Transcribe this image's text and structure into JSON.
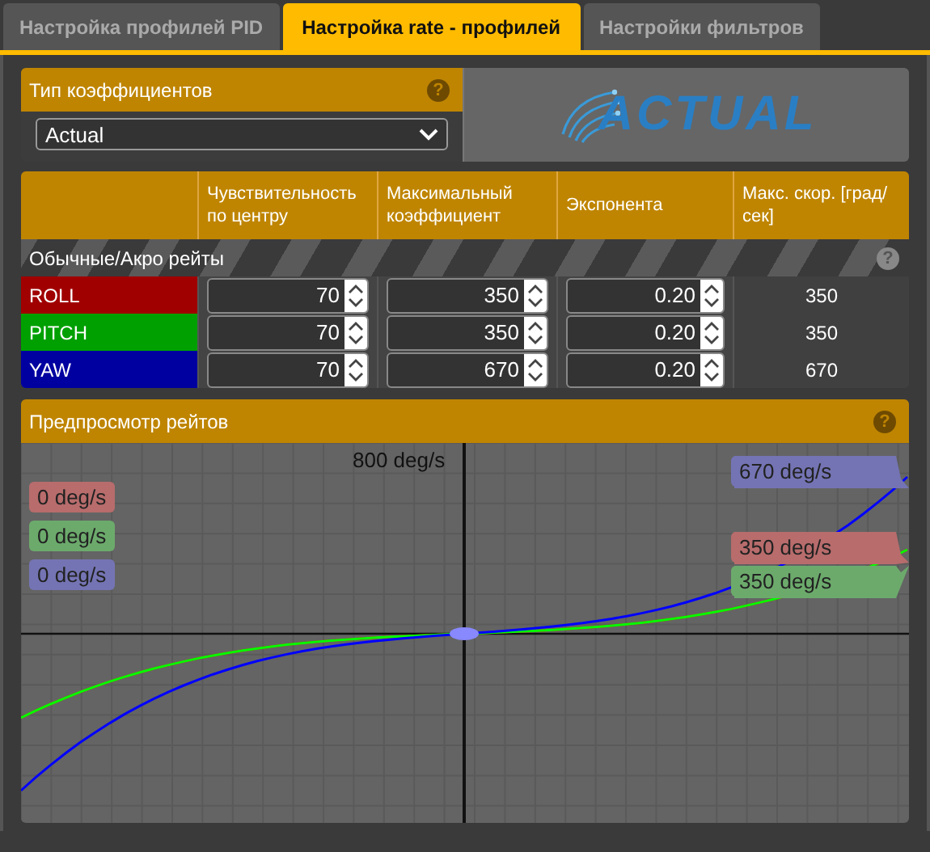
{
  "tabs": [
    {
      "label": "Настройка профилей PID",
      "selected": false
    },
    {
      "label": "Настройка rate - профилей",
      "selected": true
    },
    {
      "label": "Настройки фильтров",
      "selected": false
    }
  ],
  "rates_type": {
    "title": "Тип коэффициентов",
    "help": "?",
    "value": "Actual"
  },
  "logo": {
    "text": "ACTUAL"
  },
  "table": {
    "columns": [
      "Чувствительность по центру",
      "Максимальный коэффициент",
      "Экспонента",
      "Макс. скор. [град/сек]"
    ],
    "group": {
      "title": "Обычные/Акро рейты",
      "help": "?"
    },
    "rows": [
      {
        "axis": "ROLL",
        "color": "#a00000",
        "center": "70",
        "max": "350",
        "expo": "0.20",
        "max_speed": "350"
      },
      {
        "axis": "PITCH",
        "color": "#00a000",
        "center": "70",
        "max": "350",
        "expo": "0.20",
        "max_speed": "350"
      },
      {
        "axis": "YAW",
        "color": "#0000a0",
        "center": "70",
        "max": "670",
        "expo": "0.20",
        "max_speed": "670"
      }
    ]
  },
  "preview": {
    "title": "Предпросмотр рейтов",
    "help": "?",
    "top_label": "800 deg/s",
    "current": [
      {
        "text": "0 deg/s",
        "color": "#b86c6c"
      },
      {
        "text": "0 deg/s",
        "color": "#6caa6c"
      },
      {
        "text": "0 deg/s",
        "color": "#7474b4"
      }
    ],
    "max_labels": [
      {
        "text": "670 deg/s",
        "color": "#7474b4"
      },
      {
        "text": "350 deg/s",
        "color": "#b86c6c"
      },
      {
        "text": "350 deg/s",
        "color": "#6caa6c"
      }
    ]
  }
}
